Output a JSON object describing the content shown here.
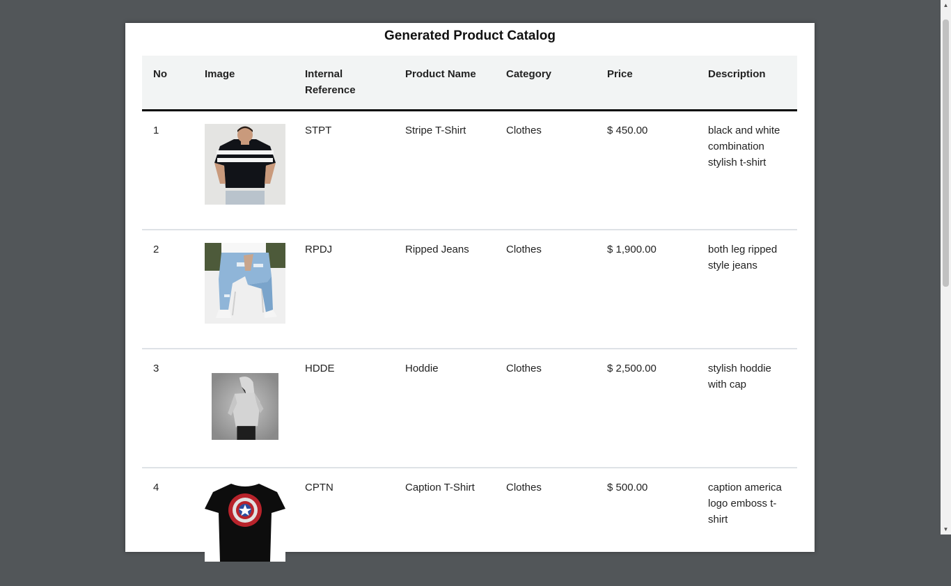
{
  "catalog": {
    "title": "Generated Product Catalog",
    "columns": [
      "No",
      "Image",
      "Internal Reference",
      "Product Name",
      "Category",
      "Price",
      "Description"
    ],
    "rows": [
      {
        "no": "1",
        "image": "stripe-tshirt-photo",
        "ref": "STPT",
        "name": "Stripe T-Shirt",
        "category": "Clothes",
        "price": "$ 450.00",
        "description": "black and white combination stylish t-shirt"
      },
      {
        "no": "2",
        "image": "ripped-jeans-photo",
        "ref": "RPDJ",
        "name": "Ripped Jeans",
        "category": "Clothes",
        "price": "$ 1,900.00",
        "description": "both leg ripped style jeans"
      },
      {
        "no": "3",
        "image": "hoodie-photo",
        "ref": "HDDE",
        "name": "Hoddie",
        "category": "Clothes",
        "price": "$ 2,500.00",
        "description": "stylish hoddie with cap"
      },
      {
        "no": "4",
        "image": "captain-tshirt-photo",
        "ref": "CPTN",
        "name": "Caption T-Shirt",
        "category": "Clothes",
        "price": "$ 500.00",
        "description": "caption america logo emboss t-shirt"
      }
    ]
  },
  "colors": {
    "viewer_background": "#525659",
    "page_background": "#ffffff",
    "header_background": "#f2f4f4",
    "header_rule": "#000000",
    "row_divider": "#dee2e6"
  }
}
